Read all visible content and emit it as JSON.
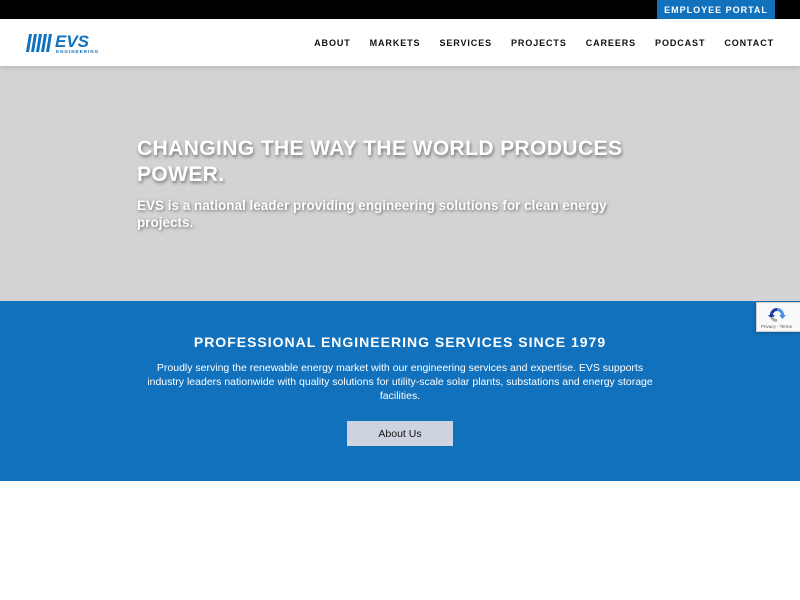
{
  "topbar": {
    "portal_label": "EMPLOYEE PORTAL"
  },
  "header": {
    "logo": {
      "name": "EVS",
      "tagline": "ENGINEERING",
      "color": "#1171bc"
    },
    "nav": [
      {
        "label": "ABOUT"
      },
      {
        "label": "MARKETS"
      },
      {
        "label": "SERVICES"
      },
      {
        "label": "PROJECTS"
      },
      {
        "label": "CAREERS"
      },
      {
        "label": "PODCAST"
      },
      {
        "label": "CONTACT"
      }
    ]
  },
  "hero": {
    "title": "CHANGING THE WAY THE WORLD PRODUCES POWER.",
    "subtitle": "EVS is a national leader providing engineering solutions for clean energy projects."
  },
  "services": {
    "title": "PROFESSIONAL ENGINEERING SERVICES SINCE 1979",
    "description": "Proudly serving the renewable energy market with our engineering services and expertise. EVS supports industry leaders nationwide with quality solutions for utility-scale solar plants, substations and energy storage facilities.",
    "button_label": "About Us"
  },
  "recaptcha": {
    "text": "Privacy - Terms",
    "icon": "recaptcha-icon"
  },
  "colors": {
    "brand_blue": "#1171bc",
    "hero_bg": "#d3d3d5",
    "topbar_bg": "#000000",
    "button_bg": "#cdd4e0"
  }
}
